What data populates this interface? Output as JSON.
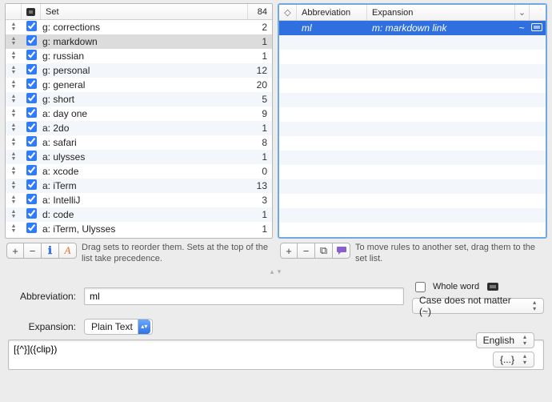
{
  "left": {
    "header": {
      "set_label": "Set",
      "total": "84"
    },
    "rows": [
      {
        "name": "g: corrections",
        "count": "2",
        "checked": true
      },
      {
        "name": "g: markdown",
        "count": "1",
        "checked": true,
        "selected": true
      },
      {
        "name": "g: russian",
        "count": "1",
        "checked": true
      },
      {
        "name": "g: personal",
        "count": "12",
        "checked": true
      },
      {
        "name": "g: general",
        "count": "20",
        "checked": true
      },
      {
        "name": "g: short",
        "count": "5",
        "checked": true
      },
      {
        "name": "a: day one",
        "count": "9",
        "checked": true
      },
      {
        "name": "a: 2do",
        "count": "1",
        "checked": true
      },
      {
        "name": "a: safari",
        "count": "8",
        "checked": true
      },
      {
        "name": "a: ulysses",
        "count": "1",
        "checked": true
      },
      {
        "name": "a: xcode",
        "count": "0",
        "checked": true
      },
      {
        "name": "a: iTerm",
        "count": "13",
        "checked": true
      },
      {
        "name": "a: IntelliJ",
        "count": "3",
        "checked": true
      },
      {
        "name": "d: code",
        "count": "1",
        "checked": true
      },
      {
        "name": "a: iTerm, Ulysses",
        "count": "1",
        "checked": true
      }
    ],
    "help": "Drag sets to reorder them. Sets at the top of the list take precedence."
  },
  "right": {
    "header": {
      "abbr_label": "Abbreviation",
      "exp_label": "Expansion"
    },
    "rows": [
      {
        "abbr": "ml",
        "expansion": "m: markdown link",
        "selected": true,
        "tilde": "~"
      }
    ],
    "blank_rows": 14,
    "help": "To move rules to another set, drag them to the set list."
  },
  "form": {
    "abbr_label": "Abbreviation:",
    "abbr_value": "ml",
    "whole_word_label": "Whole word",
    "case_label": "Case does not matter (~)",
    "exp_label": "Expansion:",
    "format_value": "Plain Text",
    "expansion_value": "[{^}]({clip})",
    "lang_value": "English",
    "insert_value": "{...}"
  },
  "glyphs": {
    "updown": "⇳",
    "diamond": "◇",
    "chev": "⌄",
    "plus": "+",
    "minus": "−",
    "info": "ℹ",
    "font": "A",
    "chat": "💬",
    "copy": "⧉",
    "grip": "▴ ▾"
  }
}
